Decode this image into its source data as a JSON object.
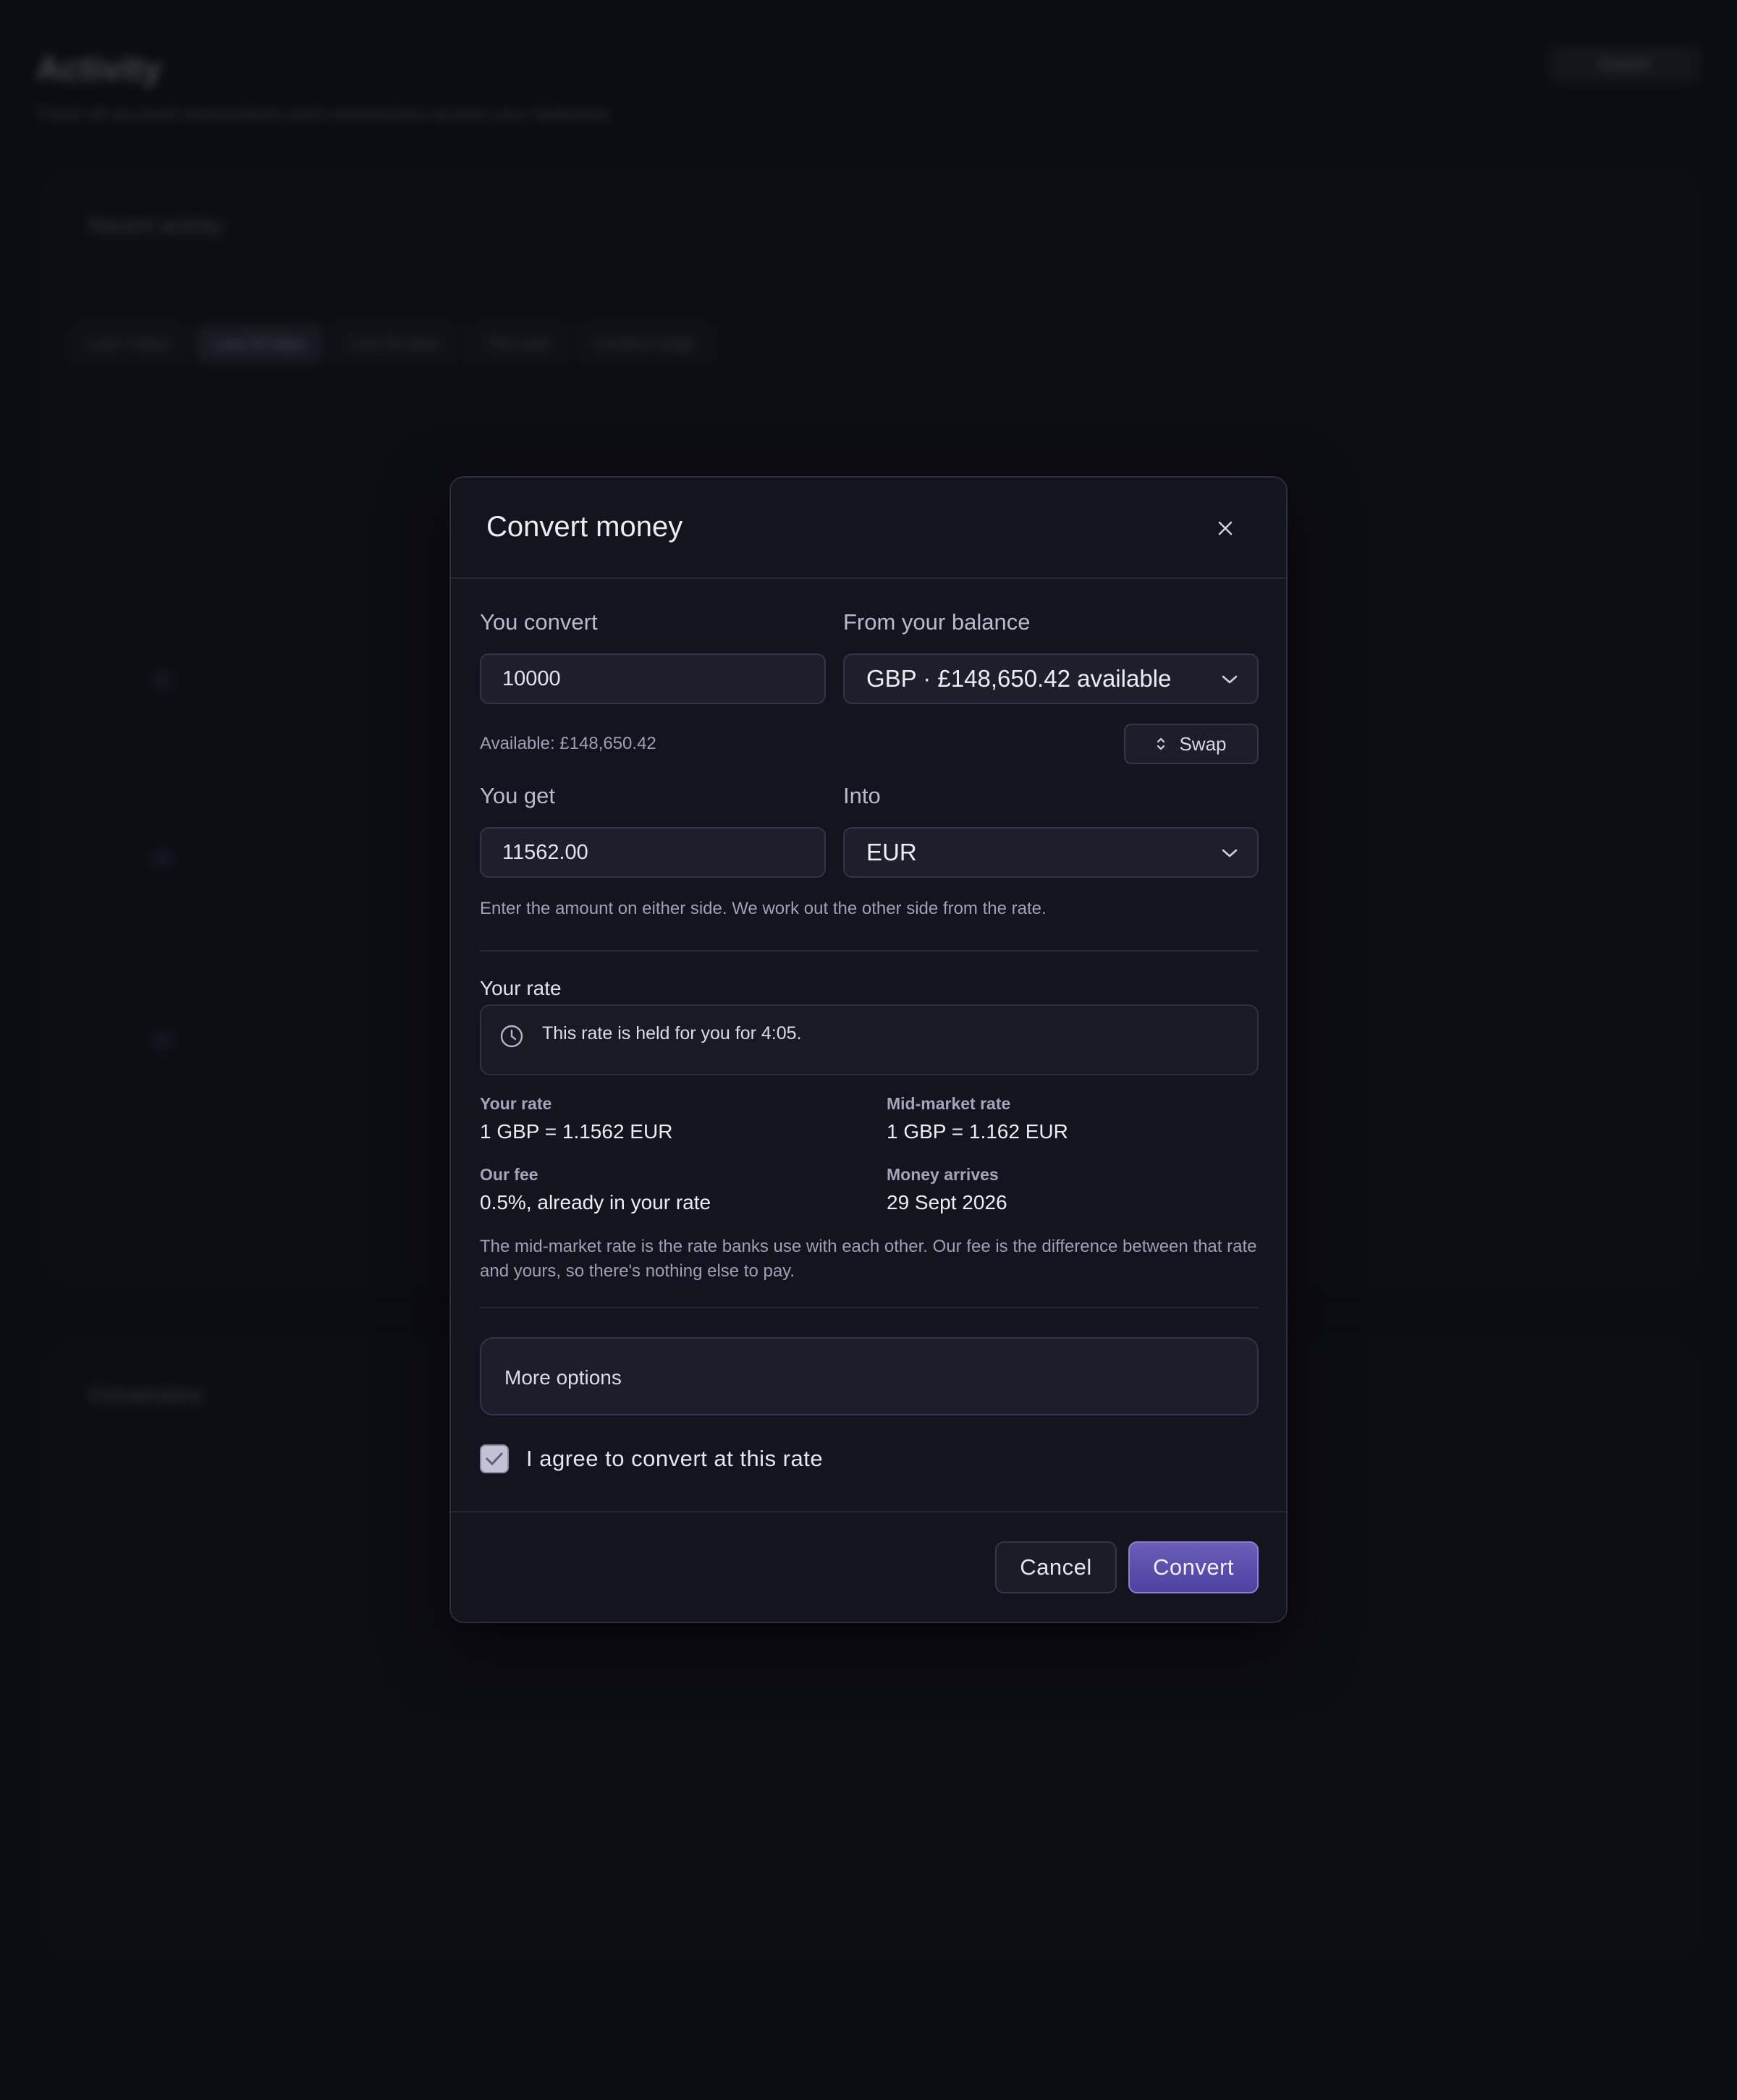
{
  "background": {
    "page_title": "Activity",
    "page_subtitle": "Track all account transactions and conversions across your balances",
    "export_label": "Export",
    "panel_title": "Recent activity",
    "filter_chips": [
      "Last 7 days",
      "Last 30 days",
      "Last 90 days",
      "This year",
      "Custom range"
    ],
    "conversions_title": "Conversions"
  },
  "modal": {
    "title": "Convert money",
    "you_convert_label": "You convert",
    "you_convert_value": "10000",
    "from_balance_label": "From your balance",
    "from_balance_value": "GBP · £148,650.42 available",
    "available_text": "Available: £148,650.42",
    "swap_label": "Swap",
    "you_get_label": "You get",
    "you_get_value": "11562.00",
    "into_label": "Into",
    "into_value": "EUR",
    "helper_text": "Enter the amount on either side. We work out the other side from the rate.",
    "rate_heading": "Your rate",
    "hold_text": "This rate is held for you for 4:05.",
    "your_rate_label": "Your rate",
    "your_rate_value": "1 GBP = 1.1562 EUR",
    "mid_market_label": "Mid-market rate",
    "mid_market_value": "1 GBP = 1.162 EUR",
    "fee_label": "Our fee",
    "fee_value": "0.5%, already in your rate",
    "arrives_label": "Money arrives",
    "arrives_value": "29 Sept 2026",
    "note": "The mid-market rate is the rate banks use with each other. Our fee is the difference between that rate and yours, so there's nothing else to pay.",
    "more_options_label": "More options",
    "agree_label": "I agree to convert at this rate",
    "agree_checked": true,
    "cancel_label": "Cancel",
    "convert_label": "Convert"
  },
  "colors": {
    "accent": "#5a4cae",
    "modal_bg": "#14141e",
    "page_bg": "#0f0f18"
  }
}
